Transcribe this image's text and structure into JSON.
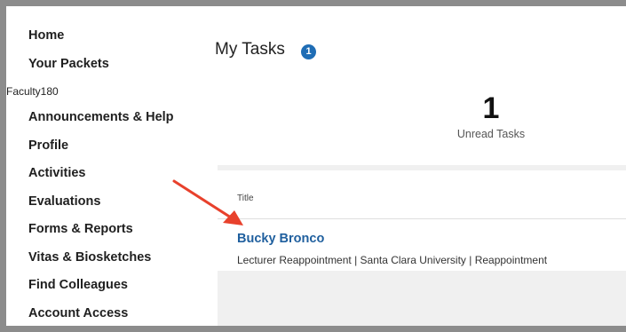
{
  "sidebar": {
    "items_top": [
      "Home",
      "Your Packets"
    ],
    "section_label": "Faculty180",
    "items": [
      "Announcements & Help",
      "Profile",
      "Activities",
      "Evaluations",
      "Forms & Reports",
      "Vitas & Biosketches",
      "Find Colleagues",
      "Account Access"
    ]
  },
  "main": {
    "title": "My Tasks",
    "badge_count": "1",
    "stat": {
      "value": "1",
      "label": "Unread Tasks"
    },
    "table": {
      "column_header": "Title",
      "rows": [
        {
          "name": "Bucky Bronco",
          "description": "Lecturer Reappointment | Santa Clara University | Reappointment"
        }
      ]
    }
  },
  "colors": {
    "badge": "#1f6db5",
    "link": "#1f5f9e",
    "arrow": "#e8412c",
    "frame": "#8c8c8c"
  }
}
